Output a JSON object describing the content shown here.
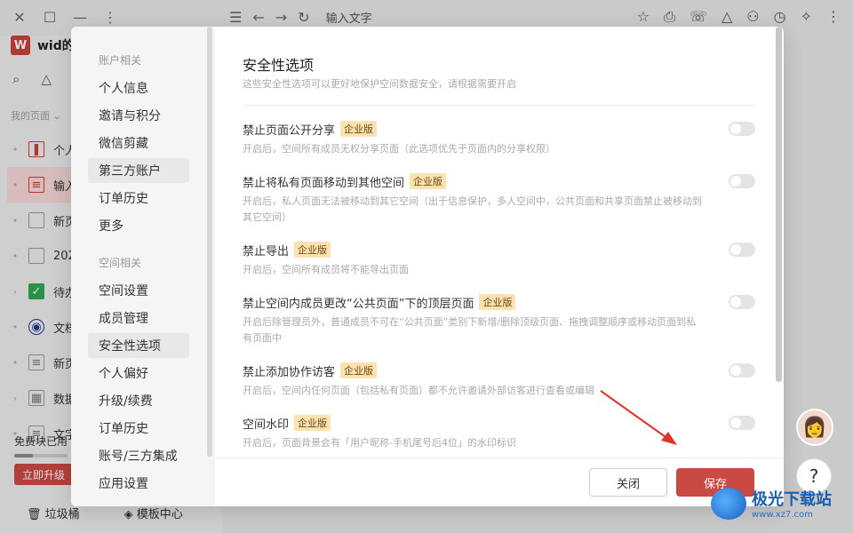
{
  "topbar": {
    "title": "输入文字",
    "window_controls": [
      "close-icon",
      "maximize-icon",
      "minimize-icon",
      "more-icon"
    ],
    "nav_icons": [
      "menu-icon",
      "back-icon",
      "forward-icon",
      "refresh-icon"
    ],
    "right_icons": [
      "star-icon",
      "share-icon",
      "comment-icon",
      "graph-icon",
      "add-user-icon",
      "history-icon",
      "magic-icon",
      "more-icon"
    ]
  },
  "sidebar": {
    "workspace_logo": "W",
    "workspace_name": "wid的",
    "my_pages_label": "我的页面 ⌄",
    "pages": [
      {
        "label": "个人",
        "icon": "bookmark-icon"
      },
      {
        "label": "输入",
        "icon": "doc-icon"
      },
      {
        "label": "新页",
        "icon": "page-icon"
      },
      {
        "label": "202",
        "icon": "page-icon"
      },
      {
        "label": "待办",
        "icon": "checkbox-icon"
      },
      {
        "label": "文档",
        "icon": "eye-icon"
      },
      {
        "label": "新页",
        "icon": "doc-icon"
      },
      {
        "label": "数据",
        "icon": "table-icon"
      },
      {
        "label": "文字",
        "icon": "doc-icon"
      }
    ],
    "free_blocks": "免费块已用",
    "usage_fraction": 0.35,
    "upgrade_button": "立即升级",
    "trash": "垃圾桶",
    "templates": "模板中心"
  },
  "modal": {
    "nav": {
      "group_account": "账户相关",
      "account_items": [
        "个人信息",
        "邀请与积分",
        "微信剪藏",
        "第三方账户",
        "订单历史",
        "更多"
      ],
      "group_space": "空间相关",
      "space_items": [
        "空间设置",
        "成员管理",
        "安全性选项",
        "个人偏好",
        "升级/续费",
        "订单历史",
        "账号/三方集成",
        "应用设置"
      ]
    },
    "title": "安全性选项",
    "subtitle": "这些安全性选项可以更好地保护空间数据安全，请根据需要开启",
    "badge": "企业版",
    "options": [
      {
        "label": "禁止页面公开分享",
        "desc": "开启后，空间所有成员无权分享页面（此选项优先于页面内的分享权限）",
        "enabled": false
      },
      {
        "label": "禁止将私有页面移动到其他空间",
        "desc": "开启后，私人页面无法被移动到其它空间（出于信息保护，多人空间中，公共页面和共享页面禁止被移动到其它空间）",
        "enabled": false
      },
      {
        "label": "禁止导出",
        "desc": "开启后，空间所有成员将不能导出页面",
        "enabled": false
      },
      {
        "label": "禁止空间内成员更改“公共页面”下的顶层页面",
        "desc": "开启后除管理员外，普通成员不可在“公共页面”类别下新增/删除顶级页面、拖拽调整顺序或移动页面到私有页面中",
        "enabled": false
      },
      {
        "label": "禁止添加协作访客",
        "desc": "开启后，空间内任何页面（包括私有页面）都不允许邀请外部访客进行查看或编辑",
        "enabled": false
      },
      {
        "label": "空间水印",
        "desc": "开启后，页面背景会有「用户昵称-手机尾号后4位」的水印标识",
        "enabled": false
      }
    ],
    "close_button": "关闭",
    "save_button": "保存"
  },
  "watermark": {
    "line1": "极光下载站",
    "line2": "www.xz7.com"
  },
  "help_label": "?",
  "colors": {
    "accent": "#c94a43",
    "badge_bg": "#fbe2b0",
    "arrow": "#e0352b"
  }
}
